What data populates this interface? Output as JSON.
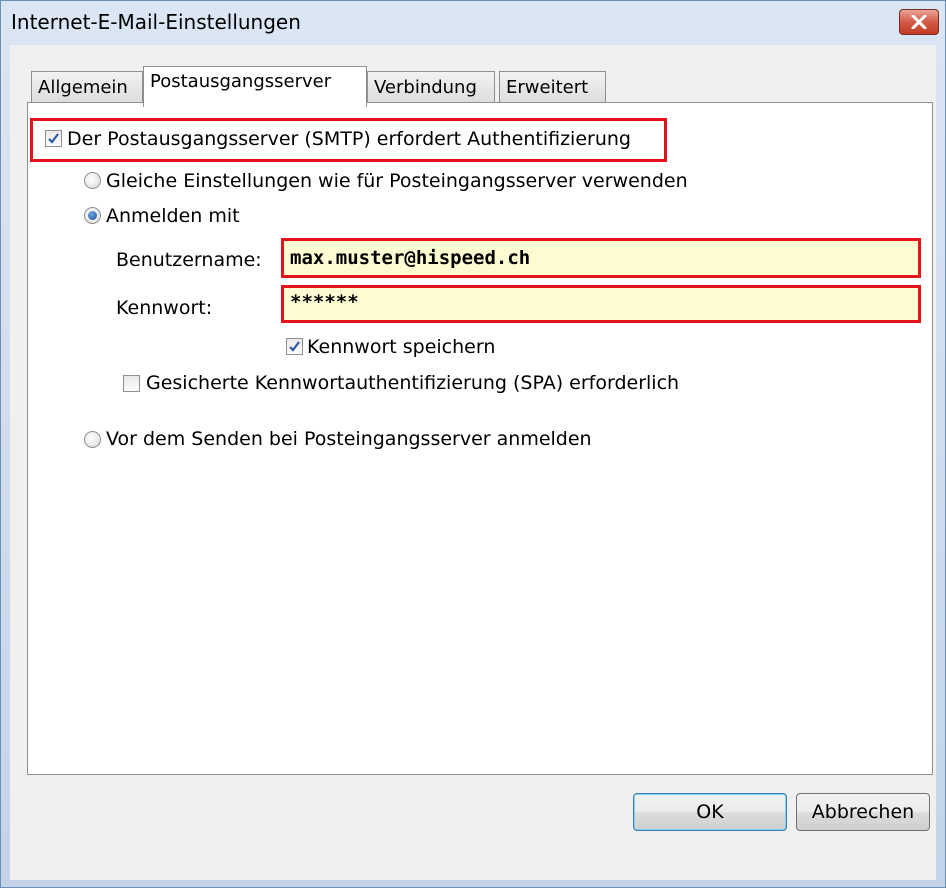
{
  "window": {
    "title": "Internet-E-Mail-Einstellungen"
  },
  "tabs": [
    {
      "label": "Allgemein"
    },
    {
      "label": "Postausgangsserver"
    },
    {
      "label": "Verbindung"
    },
    {
      "label": "Erweitert"
    }
  ],
  "auth": {
    "requires_auth_label": "Der Postausgangsserver (SMTP) erfordert Authentifizierung",
    "requires_auth_checked": true,
    "same_settings_label": "Gleiche Einstellungen wie für Posteingangsserver verwenden",
    "login_with_label": "Anmelden mit",
    "selected_option": "login_with",
    "username_label": "Benutzername:",
    "username_value": "max.muster@hispeed.ch",
    "password_label": "Kennwort:",
    "password_value": "******",
    "save_password_label": "Kennwort speichern",
    "save_password_checked": true,
    "spa_label": "Gesicherte Kennwortauthentifizierung (SPA) erforderlich",
    "spa_checked": false,
    "login_before_send_label": "Vor dem Senden bei Posteingangsserver anmelden"
  },
  "buttons": {
    "ok": "OK",
    "cancel": "Abbrechen"
  },
  "colors": {
    "highlight": "#e3121b",
    "input_bg": "#fcfbd2"
  }
}
